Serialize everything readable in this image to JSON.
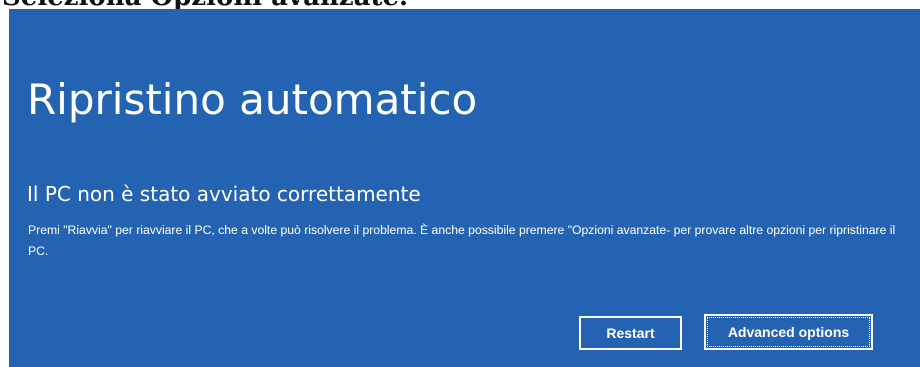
{
  "caption": {
    "text": "Seleziona Opzioni avanzate."
  },
  "recovery_screen": {
    "title": "Ripristino automatico",
    "subtitle": "Il PC non è stato avviato correttamente",
    "message": "Premi \"Riavvia\" per riavviare il PC, che a volte può risolvere il problema. È anche possibile premere \"Opzioni avanzate- per provare altre opzioni per ripristinare il PC.",
    "background_color": "#2463b1",
    "text_color": "#ffffff",
    "buttons": {
      "restart_label": "Restart",
      "advanced_label": "Advanced options",
      "focused": "advanced"
    }
  }
}
